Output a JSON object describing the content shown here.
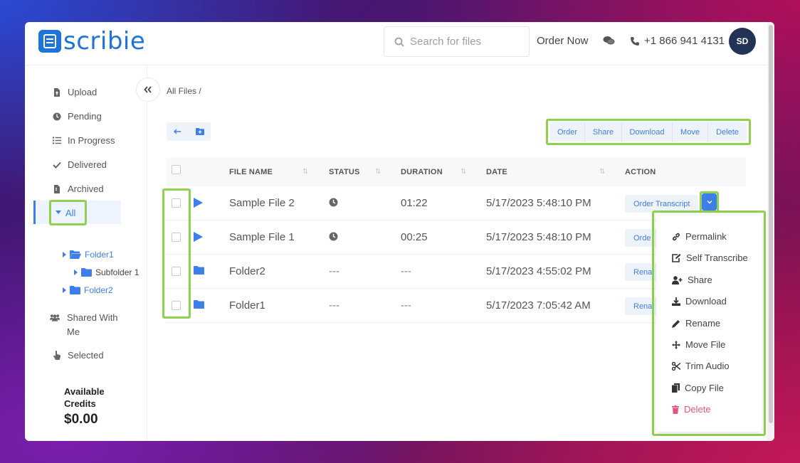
{
  "header": {
    "logo_text": "scribie",
    "search_placeholder": "Search for files",
    "order_now": "Order Now",
    "phone": "+1 866 941 4131",
    "avatar_initials": "SD"
  },
  "sidebar": {
    "items": [
      {
        "label": "Upload",
        "icon": "file-upload-icon"
      },
      {
        "label": "Pending",
        "icon": "clock-icon"
      },
      {
        "label": "In Progress",
        "icon": "list-icon"
      },
      {
        "label": "Delivered",
        "icon": "check-icon"
      },
      {
        "label": "Archived",
        "icon": "file-archive-icon"
      }
    ],
    "all_label": "All",
    "tree": [
      {
        "label": "Folder1"
      },
      {
        "label": "Subfolder 1"
      },
      {
        "label": "Folder2"
      }
    ],
    "shared_label_1": "Shared With",
    "shared_label_2": "Me",
    "selected_label": "Selected",
    "credits_label": "Available Credits",
    "credits_value": "$0.00"
  },
  "main": {
    "breadcrumb": "All Files  /",
    "toolbar": [
      "Order",
      "Share",
      "Download",
      "Move",
      "Delete"
    ],
    "columns": {
      "file_name": "FILE NAME",
      "status": "STATUS",
      "duration": "DURATION",
      "date": "DATE",
      "action": "ACTION"
    },
    "rows": [
      {
        "name": "Sample File 2",
        "type": "file",
        "duration": "01:22",
        "date": "5/17/2023 5:48:10 PM",
        "action": "Order Transcript"
      },
      {
        "name": "Sample File 1",
        "type": "file",
        "duration": "00:25",
        "date": "5/17/2023 5:48:10 PM",
        "action": "Orde"
      },
      {
        "name": "Folder2",
        "type": "folder",
        "status": "---",
        "duration": "---",
        "date": "5/17/2023 4:55:02 PM",
        "action": "Renai"
      },
      {
        "name": "Folder1",
        "type": "folder",
        "status": "---",
        "duration": "---",
        "date": "5/17/2023 7:05:42 AM",
        "action": "Renai"
      }
    ]
  },
  "dropdown_menu": {
    "items": [
      "Permalink",
      "Self Transcribe",
      "Share",
      "Download",
      "Rename",
      "Move File",
      "Trim Audio",
      "Copy File",
      "Delete"
    ]
  },
  "colors": {
    "accent": "#3d7ee8",
    "highlight": "#8fd14f",
    "danger": "#e5557a"
  }
}
